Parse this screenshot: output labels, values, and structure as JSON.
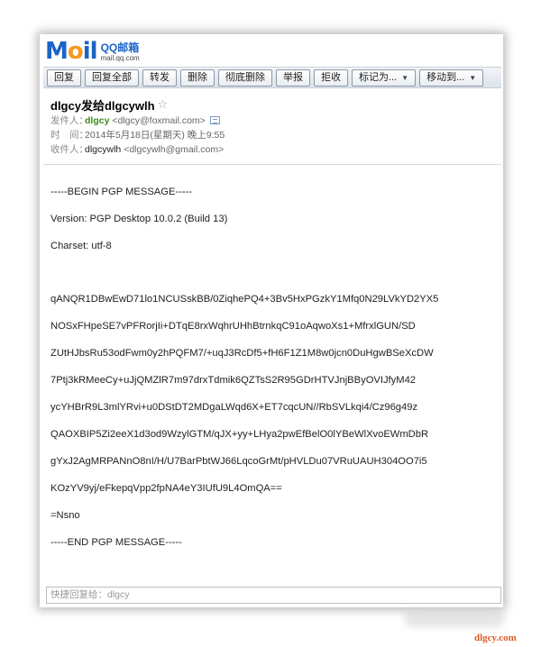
{
  "logo": {
    "mail": [
      "M",
      "o",
      "i",
      "l"
    ],
    "qq": "QQ邮箱",
    "domain": "mail.qq.com"
  },
  "toolbar": {
    "buttons": [
      "回复",
      "回复全部",
      "转发",
      "删除",
      "彻底删除",
      "举报",
      "拒收"
    ],
    "dropdowns": [
      "标记为...",
      "移动到..."
    ]
  },
  "mail": {
    "subject": "dlgcy发给dlgcywlh",
    "star": "☆",
    "from": {
      "label": "发件人：",
      "name": "dlgcy",
      "address": "<dlgcy@foxmail.com>"
    },
    "time": {
      "label": "时　间：",
      "value": "2014年5月18日(星期天) 晚上9:55"
    },
    "to": {
      "label": "收件人：",
      "name": "dlgcywlh",
      "address": "<dlgcywlh@gmail.com>"
    },
    "body_head": [
      "-----BEGIN PGP MESSAGE-----",
      "Version: PGP Desktop 10.0.2 (Build 13)",
      "Charset: utf-8"
    ],
    "body_main": [
      "qANQR1DBwEwD71lo1NCUSskBB/0ZiqhePQ4+3Bv5HxPGzkY1Mfq0N29LVkYD2YX5",
      "NOSxFHpeSE7vPFRorjIi+DTqE8rxWqhrUHhBtrnkqC91oAqwoXs1+MfrxlGUN/SD",
      "ZUtHJbsRu53odFwm0y2hPQFM7/+uqJ3RcDf5+fH6F1Z1M8w0jcn0DuHgwBSeXcDW",
      "7Ptj3kRMeeCy+uJjQMZlR7m97drxTdmik6QZTsS2R95GDrHTVJnjBByOVIJfyM42",
      "ycYHBrR9L3mlYRvi+u0DStDT2MDgaLWqd6X+ET7cqcUN//RbSVLkqi4/Cz96g49z",
      "QAOXBIP5Zi2eeX1d3od9WzylGTM/qJX+yy+LHya2pwEfBelO0lYBeWlXvoEWmDbR",
      "gYxJ2AgMRPANnO8nI/H/U7BarPbtWJ66LqcoGrMt/pHVLDu07VRuUAUH304OO7i5",
      "KOzYV9yj/eFkepqVpp2fpNA4eY3IUfU9L4OmQA==",
      "=Nsno",
      "-----END PGP MESSAGE-----"
    ]
  },
  "quick_reply": {
    "placeholder": "快捷回复给：dlgcy"
  },
  "watermark": "dlgcy.com",
  "colors": {
    "logo_blue": "#1a64c8",
    "logo_orange": "#f39a1e",
    "sender_green": "#3d8b1a",
    "watermark": "#e05a2a"
  }
}
